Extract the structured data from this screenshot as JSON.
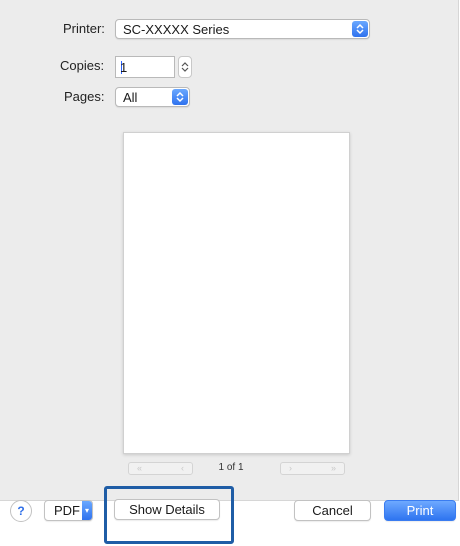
{
  "printer": {
    "label": "Printer:",
    "value": "SC-XXXXX Series"
  },
  "copies": {
    "label": "Copies:",
    "value": "1"
  },
  "pages": {
    "label": "Pages:",
    "value": "All"
  },
  "preview": {
    "page_counter": "1 of 1"
  },
  "footer": {
    "help_label": "?",
    "pdf_label": "PDF",
    "show_details_label": "Show Details",
    "cancel_label": "Cancel",
    "print_label": "Print"
  },
  "colors": {
    "accent": "#2f72ee",
    "highlight_box": "#1f5da6",
    "dialog_bg": "#ececec"
  }
}
